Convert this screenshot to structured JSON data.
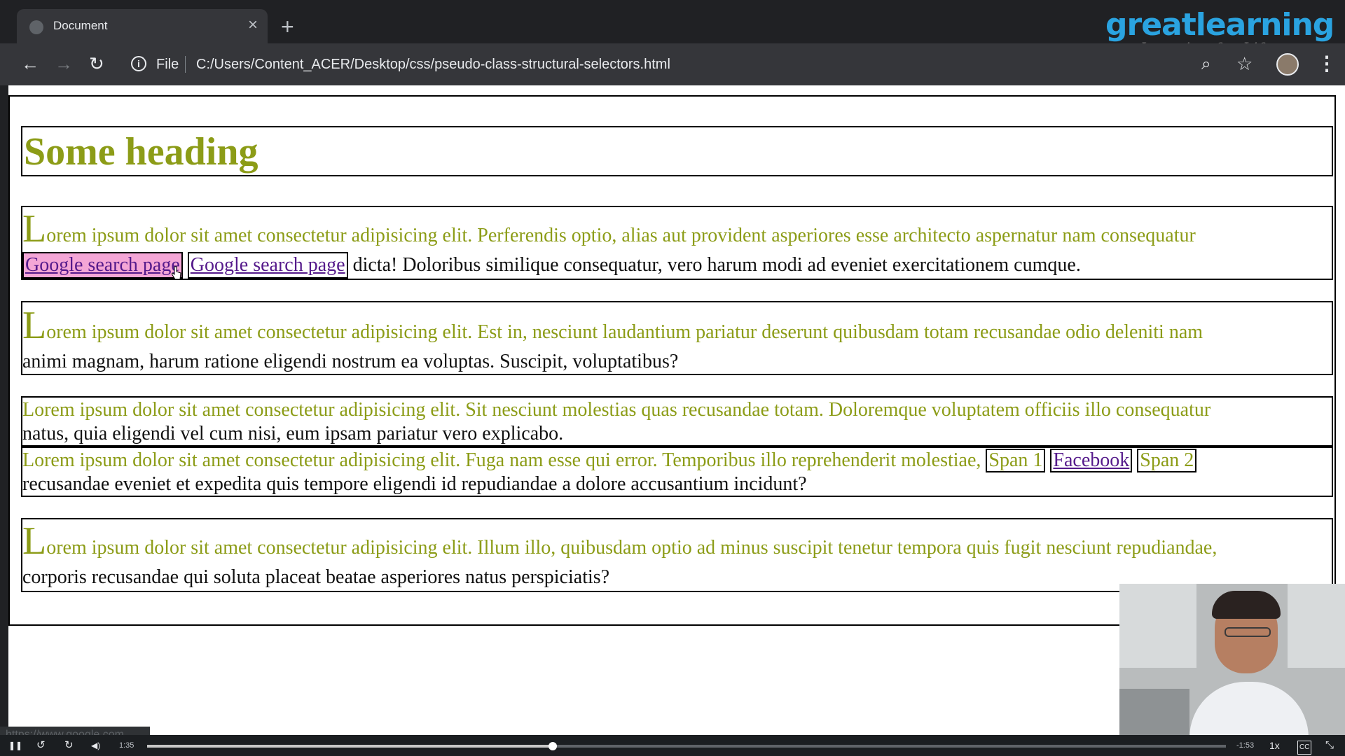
{
  "browser": {
    "tab_title": "Document",
    "close_glyph": "×",
    "new_tab_glyph": "+",
    "back_glyph": "←",
    "forward_glyph": "→",
    "reload_glyph": "↻",
    "info_glyph": "i",
    "scheme_label": "File",
    "url": "C:/Users/Content_ACER/Desktop/css/pseudo-class-structural-selectors.html",
    "zoom_glyph": "⌕",
    "star_glyph": "☆",
    "menu_glyph": "⋮"
  },
  "watermark": {
    "brand": "greatlearning",
    "tagline": "Learning for Life"
  },
  "page": {
    "heading": "Some heading",
    "p1": {
      "first_letter": "L",
      "olive_text": "orem ipsum dolor sit amet consectetur adipisicing elit. Perferendis optio, alias aut provident asperiores esse architecto aspernatur nam consequatur",
      "link1": "Google search page",
      "link2": "Google search page",
      "rest": " dicta! Doloribus similique consequatur, vero harum modi ad eveniet exercitationem cumque."
    },
    "p2": {
      "first_letter": "L",
      "olive_text": "orem ipsum dolor sit amet consectetur adipisicing elit. Est in, nesciunt laudantium pariatur deserunt quibusdam totam recusandae odio deleniti nam",
      "rest": "animi magnam, harum ratione eligendi nostrum ea voluptas. Suscipit, voluptatibus?"
    },
    "p3": {
      "olive_text": "Lorem ipsum dolor sit amet consectetur adipisicing elit. Sit nesciunt molestias quas recusandae totam. Doloremque voluptatem officiis illo consequatur",
      "rest": "natus, quia eligendi vel cum nisi, eum ipsam pariatur vero explicabo."
    },
    "p4": {
      "olive_text": "Lorem ipsum dolor sit amet consectetur adipisicing elit. Fuga nam esse qui error. Temporibus illo reprehenderit molestiae,",
      "span1": "Span 1",
      "link": "Facebook",
      "span2": "Span 2",
      "rest": "recusandae eveniet et expedita quis tempore eligendi id repudiandae a dolore accusantium incidunt?"
    },
    "p5": {
      "first_letter": "L",
      "olive_text": "orem ipsum dolor sit amet consectetur adipisicing elit. Illum illo, quibusdam optio ad minus suscipit tenetur tempora quis fugit nesciunt repudiandae,",
      "rest": "corporis recusandae qui soluta placeat beatae asperiores natus perspiciatis?"
    }
  },
  "status_bar_url": "https://www.google.com",
  "player": {
    "pause_glyph": "❚❚",
    "rewind_glyph": "↺",
    "forward_glyph": "↻",
    "volume_glyph": "◀)",
    "elapsed": "1:35",
    "remaining": "-1:53",
    "speed": "1x",
    "cc_glyph": "CC",
    "fullscreen_glyph": "⤡",
    "progress": 0.376
  },
  "colors": {
    "accent_olive": "#8c9c17",
    "link_visited": "#551a8b",
    "hover_highlight": "#f4a6d6"
  }
}
